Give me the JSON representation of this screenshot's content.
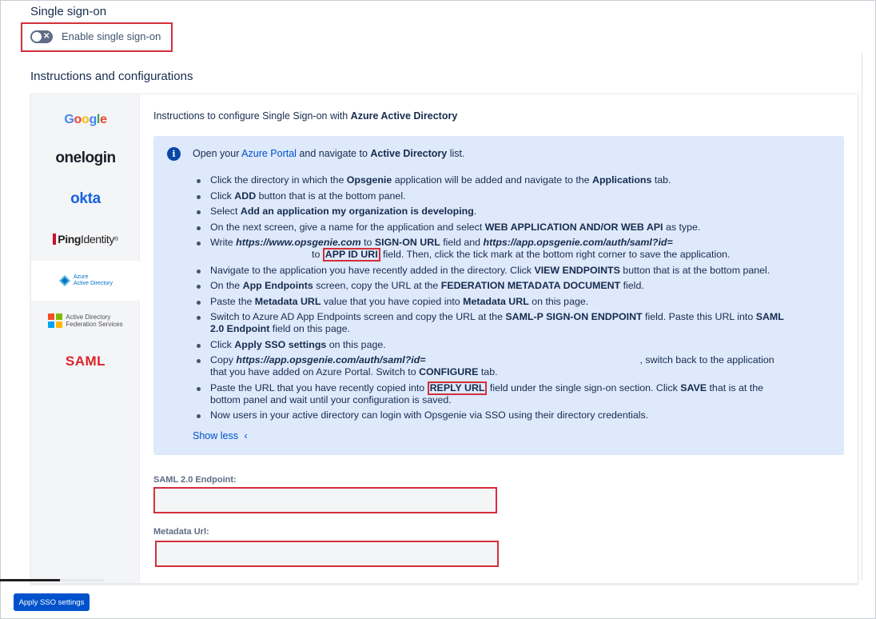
{
  "sso": {
    "title": "Single sign-on",
    "toggle_label": "Enable single sign-on",
    "toggle_state": "off"
  },
  "section_title": "Instructions and configurations",
  "providers": [
    {
      "name": "Google"
    },
    {
      "name": "onelogin"
    },
    {
      "name": "okta"
    },
    {
      "name_main": "Ping",
      "name_light": "Identity",
      "mark": "®"
    },
    {
      "line1": "Azure",
      "line2": "Active Directory",
      "active": true
    },
    {
      "line1": "Active Directory",
      "line2": "Federation Services"
    },
    {
      "name": "SAML"
    }
  ],
  "instructions": {
    "intro_prefix": "Instructions to configure Single Sign-on with ",
    "intro_bold": "Azure Active Directory",
    "open_prefix": "Open your ",
    "open_link": "Azure Portal",
    "open_middle": " and navigate to ",
    "open_bold": "Active Directory",
    "open_suffix": " list.",
    "steps": [
      {
        "a": "Click the directory in which the ",
        "b": "Opsgenie",
        "c": " application will be added and navigate to the ",
        "d": "Applications",
        "e": " tab."
      },
      {
        "a": "Click ",
        "b": "ADD",
        "c": " button that is at the bottom panel."
      },
      {
        "a": "Select ",
        "b": "Add an application my organization is developing",
        "c": "."
      },
      {
        "a": "On the next screen, give a name for the application and select ",
        "b": "WEB APPLICATION AND/OR WEB API",
        "c": " as type."
      },
      {
        "a": "Write ",
        "b": "https://www.opsgenie.com",
        "c": " to ",
        "d": "SIGN-ON URL",
        "e": " field and ",
        "f": "https://app.opsgenie.com/auth/saml?id=",
        "g": "to ",
        "h": "APP ID URI",
        "i": " field. Then, click the tick mark at the bottom right corner to save the application."
      },
      {
        "a": "Navigate to the application you have recently added in the directory. Click ",
        "b": "VIEW ENDPOINTS",
        "c": " button that is at the bottom panel."
      },
      {
        "a": "On the ",
        "b": "App Endpoints",
        "c": " screen, copy the URL at the ",
        "d": "FEDERATION METADATA DOCUMENT",
        "e": " field."
      },
      {
        "a": "Paste the ",
        "b": "Metadata URL",
        "c": " value that you have copied into ",
        "d": "Metadata URL",
        "e": " on this page."
      },
      {
        "a": "Switch to Azure AD App Endpoints screen and copy the URL at the ",
        "b": "SAML-P SIGN-ON ENDPOINT",
        "c": " field. Paste this URL into ",
        "d": "SAML",
        "e": "2.0 Endpoint",
        "f": " field on this page."
      },
      {
        "a": "Click ",
        "b": "Apply SSO settings",
        "c": " on this page."
      },
      {
        "a": "Copy ",
        "b": "https://app.opsgenie.com/auth/saml?id=",
        "c": ", switch back to the application",
        "d": "that you have added on Azure Portal. Switch to ",
        "e": "CONFIGURE",
        "f": " tab."
      },
      {
        "a": "Paste the URL that you have recently copied into ",
        "b": "REPLY URL",
        "c": " field under the single sign-on section. Click ",
        "d": "SAVE",
        "e": " that is at the",
        "f": "bottom panel and wait until your configuration is saved."
      },
      {
        "a": "Now users in your active directory can login with Opsgenie via SSO using their directory credentials."
      }
    ],
    "show_less": "Show less",
    "show_less_icon": "chevron-left-icon"
  },
  "fields": {
    "saml_endpoint": {
      "label": "SAML 2.0 Endpoint:",
      "value": "",
      "placeholder": ""
    },
    "metadata_url": {
      "label": "Metadata Url:",
      "value": "",
      "placeholder": ""
    }
  },
  "apply_button": "Apply SSO settings",
  "colors": {
    "accent": "#0052cc",
    "highlight_border": "#d32f3a",
    "info_bg": "#dee9fc"
  }
}
